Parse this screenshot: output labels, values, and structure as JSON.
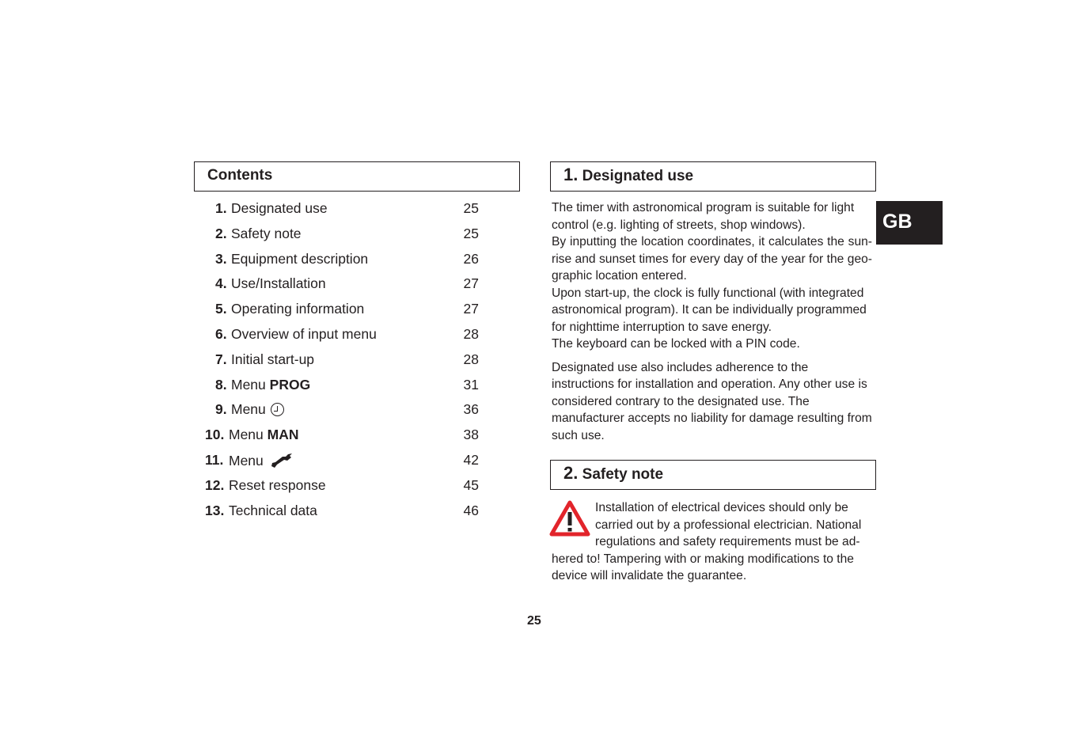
{
  "contents": {
    "title": "Contents",
    "items": [
      {
        "num": "1.",
        "label": "Designated use",
        "page": "25"
      },
      {
        "num": "2.",
        "label": "Safety note",
        "page": "25"
      },
      {
        "num": "3.",
        "label": "Equipment description",
        "page": "26"
      },
      {
        "num": "4.",
        "label": "Use/Installation",
        "page": "27"
      },
      {
        "num": "5.",
        "label": "Operating information",
        "page": "27"
      },
      {
        "num": "6.",
        "label": "Overview of input menu",
        "page": "28"
      },
      {
        "num": "7.",
        "label": "Initial start-up",
        "page": "28"
      },
      {
        "num": "8.",
        "label": "Menu",
        "bold_suffix": "PROG",
        "page": "31"
      },
      {
        "num": "9.",
        "label": "Menu",
        "icon": "clock-icon",
        "page": "36"
      },
      {
        "num": "10.",
        "label": "Menu",
        "bold_suffix": "MAN",
        "page": "38"
      },
      {
        "num": "11.",
        "label": "Menu",
        "icon": "wrench-icon",
        "page": "42"
      },
      {
        "num": "12.",
        "label": "Reset response",
        "page": "45"
      },
      {
        "num": "13.",
        "label": "Technical data",
        "page": "46"
      }
    ]
  },
  "section1": {
    "num": "1.",
    "title": "Designated use",
    "paragraph1": [
      "The timer with astronomical program is suitable for light control (e.g. lighting of streets, shop windows).",
      "By inputting the location coordinates, it calculates the sun­rise and sunset times for every day of the year for the geo­graphic location entered.",
      "Upon start-up, the clock is fully functional (with integrated astronomical program). It can be individually programmed for nighttime interruption to save energy.",
      "The keyboard can be locked with a PIN code."
    ],
    "paragraph2": "Designated use also includes adherence to the instructions for installation and operation. Any other use is considered contrary to the designated use. The manufacturer accepts no liability for damage resulting from such use."
  },
  "section2": {
    "num": "2.",
    "title": "Safety note",
    "icon": "warning-icon",
    "text": "Installation of electrical devices should only be carried out by a professional electrician. National regulations and safety requirements must be ad­hered to! Tampering with or making modifications to the device will invalidate the guarantee."
  },
  "language_tab": "GB",
  "page_number": "25",
  "colors": {
    "text": "#231f20",
    "warning_red": "#e2242b",
    "tab_bg": "#231f20"
  }
}
